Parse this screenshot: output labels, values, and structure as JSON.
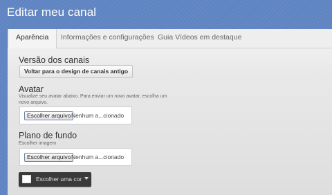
{
  "page_title": "Editar meu canal",
  "tabs": [
    {
      "label": "Aparência",
      "active": true
    },
    {
      "label": "Informações e configurações",
      "active": false
    },
    {
      "label": "Guia Vídeos em destaque",
      "active": false
    }
  ],
  "channel_version": {
    "title": "Versão dos canais",
    "button_label": "Voltar para o design de canais antigo"
  },
  "avatar": {
    "title": "Avatar",
    "description": "Visualize seu avatar abaixo. Para enviar um novo avatar, escolha um novo arquivo.",
    "file_button": "Escolher arquivo",
    "file_status": "Nenhum a...cionado"
  },
  "background": {
    "title": "Plano de fundo",
    "description": "Escolher imagem",
    "file_button": "Escolher arquivo",
    "file_status": "Nenhum a...cionado"
  },
  "color_picker": {
    "label": "Escolher uma cor",
    "swatch_color": "#ffffff"
  },
  "colors": {
    "background_blue": "#5f84c2",
    "panel": "#eeeeee",
    "picker_bg": "#3a3a3a"
  }
}
